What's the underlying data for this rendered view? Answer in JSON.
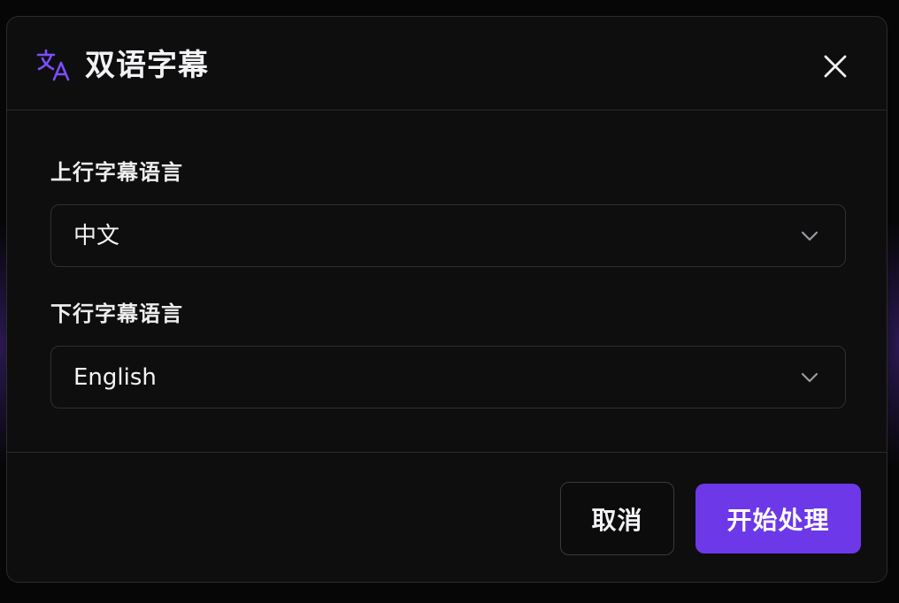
{
  "dialog": {
    "title": "双语字幕",
    "title_icon": "translate-icon",
    "close_icon": "close-icon"
  },
  "fields": {
    "top": {
      "label": "上行字幕语言",
      "value": "中文",
      "icon": "chevron-down-icon"
    },
    "bottom": {
      "label": "下行字幕语言",
      "value": "English",
      "icon": "chevron-down-icon"
    }
  },
  "footer": {
    "cancel_label": "取消",
    "confirm_label": "开始处理"
  },
  "colors": {
    "accent": "#6d38e8",
    "background": "#0e0e0f",
    "border": "#2b2b2e",
    "text": "#f2f2f4"
  }
}
